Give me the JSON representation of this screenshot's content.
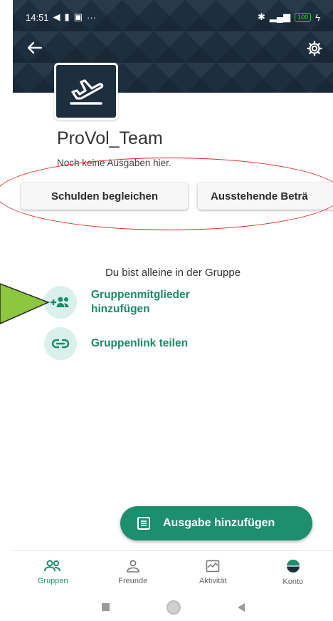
{
  "status_bar": {
    "time": "14:51",
    "more": "···",
    "battery": "100"
  },
  "group": {
    "name": "ProVol_Team",
    "subtitle": "Noch keine Ausgaben hier."
  },
  "buttons": {
    "settle": "Schulden begleichen",
    "pending": "Ausstehende Beträ"
  },
  "empty_state": {
    "message": "Du bist alleine in der Gruppe",
    "add_members": [
      "Gruppenmitglieder",
      "hinzufügen"
    ],
    "share_link": "Gruppenlink teilen"
  },
  "fab": {
    "label": "Ausgabe hinzufügen"
  },
  "bottom_nav": {
    "items": [
      {
        "label": "Gruppen",
        "icon": "group-icon",
        "active": true
      },
      {
        "label": "Freunde",
        "icon": "person-icon",
        "active": false
      },
      {
        "label": "Aktivität",
        "icon": "activity-icon",
        "active": false
      },
      {
        "label": "Konto",
        "icon": "account-icon",
        "active": false
      }
    ]
  },
  "colors": {
    "accent": "#1e8f6e",
    "header": "#1d2e3f",
    "annotation_red": "#e02020",
    "annotation_green": "#8dc63f"
  }
}
